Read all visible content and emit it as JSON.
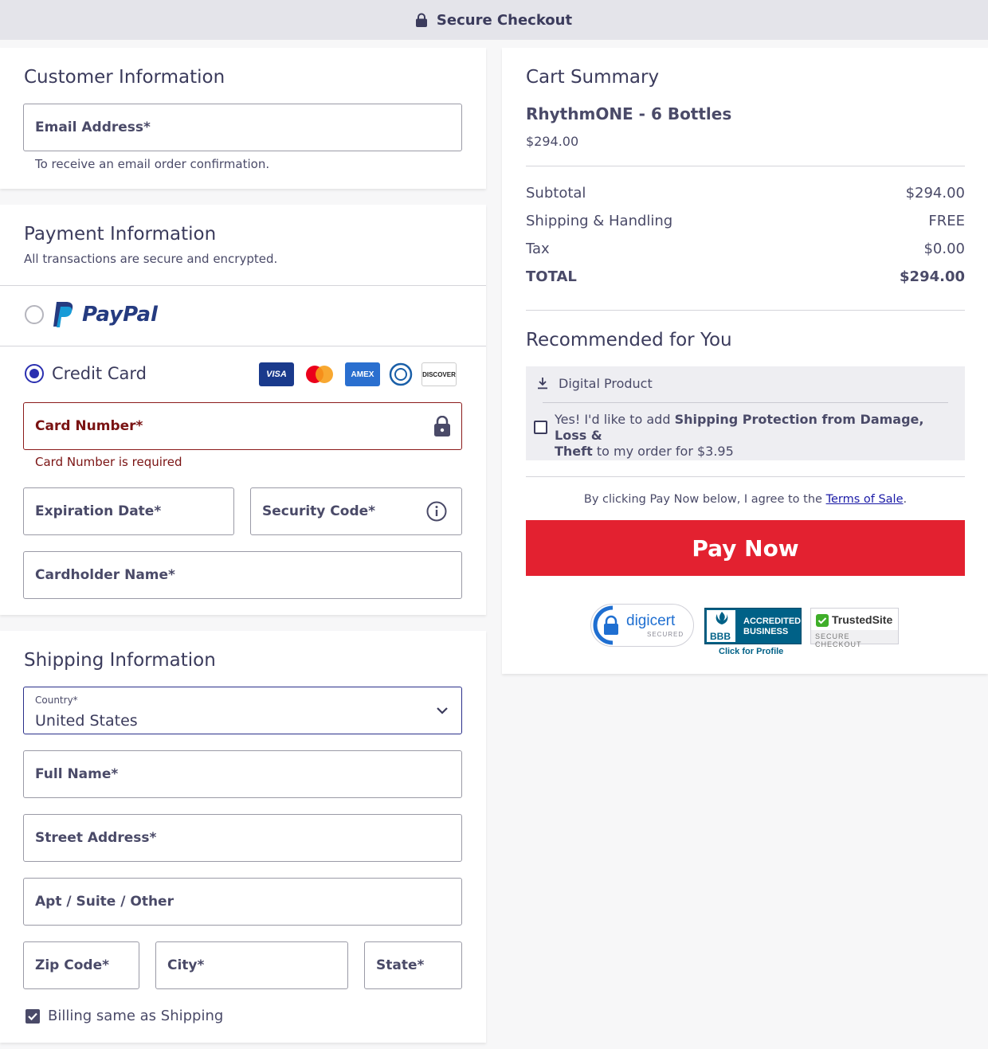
{
  "header": {
    "title": "Secure Checkout"
  },
  "customer": {
    "title": "Customer Information",
    "email_label": "Email Address*",
    "email_helper": "To receive an email order confirmation."
  },
  "payment": {
    "title": "Payment Information",
    "subtitle": "All transactions are secure and encrypted.",
    "paypal_label": "PayPal",
    "credit_card_label": "Credit Card",
    "card_logos": [
      "VISA",
      "AMEX",
      "DISCOVER"
    ],
    "card_number_label": "Card Number*",
    "card_number_error": "Card Number is required",
    "expiration_label": "Expiration Date*",
    "security_code_label": "Security Code*",
    "cardholder_label": "Cardholder Name*"
  },
  "shipping": {
    "title": "Shipping Information",
    "country_label": "Country*",
    "country_value": "United States",
    "full_name_label": "Full Name*",
    "street_label": "Street Address*",
    "apt_label": "Apt / Suite / Other",
    "zip_label": "Zip Code*",
    "city_label": "City*",
    "state_label": "State*",
    "billing_same_label": "Billing same as Shipping",
    "billing_same_checked": true
  },
  "cart": {
    "title": "Cart Summary",
    "product_name": "RhythmONE - 6 Bottles",
    "product_price": "$294.00",
    "subtotal_label": "Subtotal",
    "subtotal_value": "$294.00",
    "shipping_label": "Shipping & Handling",
    "shipping_value": "FREE",
    "tax_label": "Tax",
    "tax_value": "$0.00",
    "total_label": "TOTAL",
    "total_value": "$294.00"
  },
  "recommended": {
    "title": "Recommended for You",
    "digital_product_label": "Digital Product",
    "offer_prefix": "Yes! I'd like to add ",
    "offer_bold1": "Shipping Protection from Damage, Loss &",
    "offer_bold2": "Theft",
    "offer_suffix": " to my order for $3.95"
  },
  "terms": {
    "prefix": "By clicking Pay Now below, I agree to the ",
    "link": "Terms of Sale",
    "suffix": "."
  },
  "pay_button_label": "Pay Now",
  "badges": {
    "digicert_name": "digicert",
    "digicert_sub": "SECURED",
    "bbb_line1": "ACCREDITED",
    "bbb_line2": "BUSINESS",
    "bbb_mark": "BBB",
    "bbb_profile": "Click for Profile",
    "trusted_name": "TrustedSite",
    "trusted_sub": "SECURE CHECKOUT"
  },
  "colors": {
    "pay_button": "#e32130",
    "error": "#8b1a1a",
    "radio_selected": "#2a2fb0",
    "link": "#1a1aa6"
  }
}
